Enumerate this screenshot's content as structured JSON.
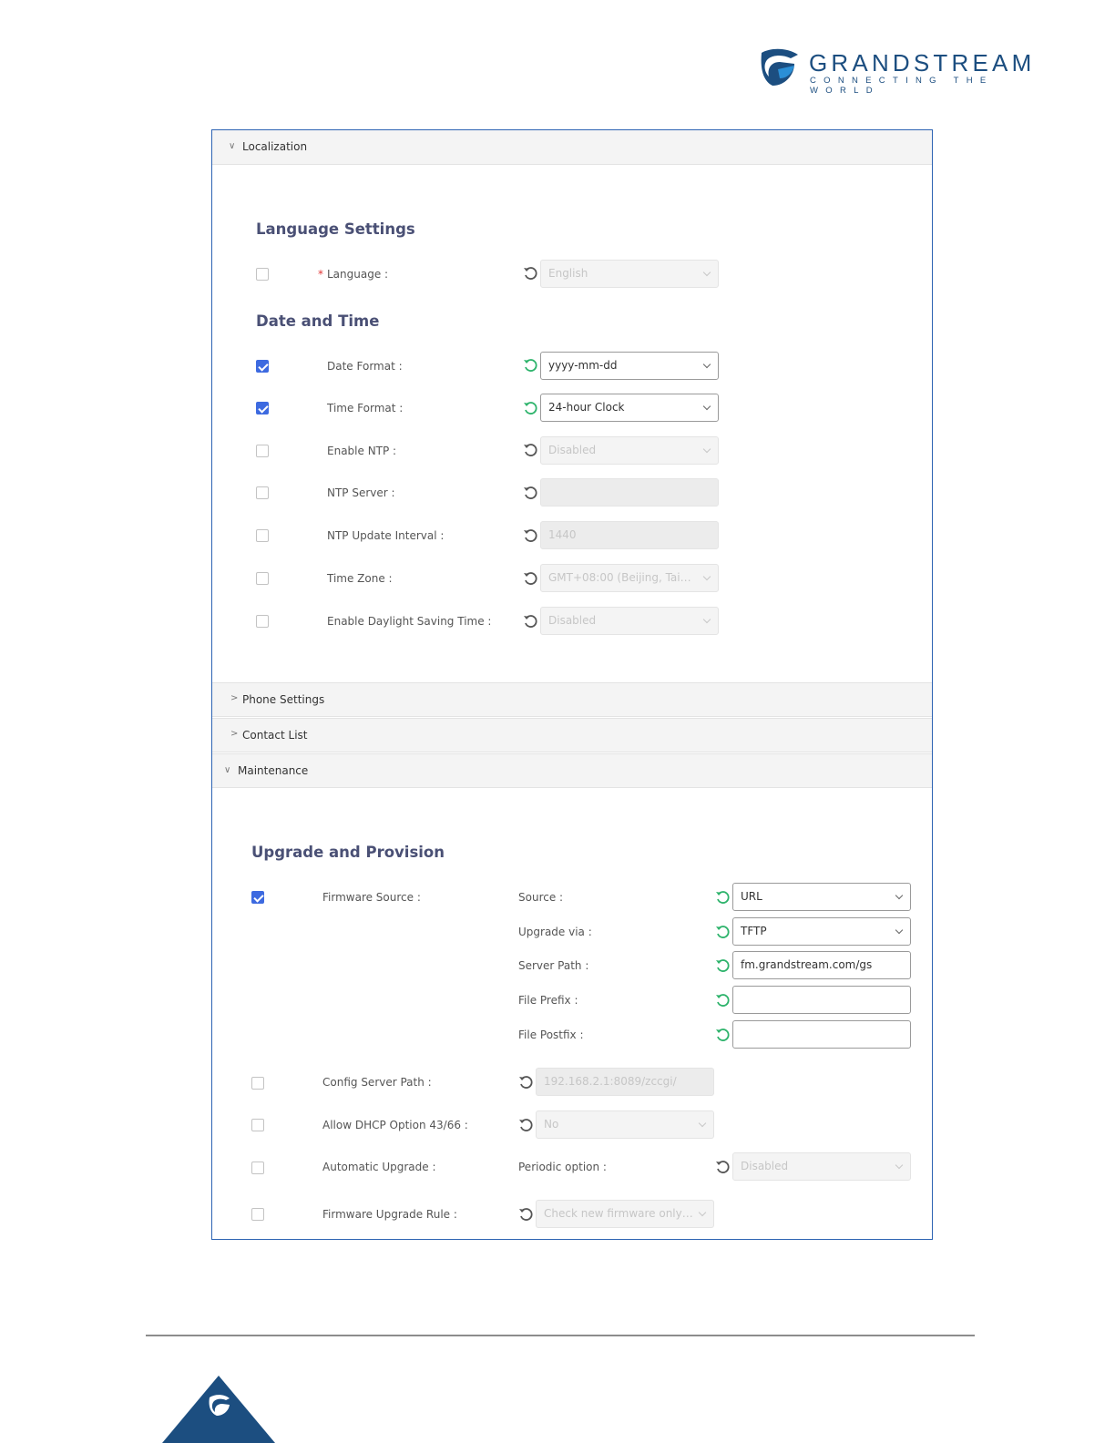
{
  "header": {
    "brand": "GRANDSTREAM",
    "tagline": "CONNECTING THE WORLD"
  },
  "colors": {
    "accent": "#3d6ae0",
    "brand": "#1c4e80",
    "reset_active": "#2db36b",
    "title": "#4a5075"
  },
  "sections": {
    "localization": "Localization",
    "phone_settings": "Phone Settings",
    "contact_list": "Contact List",
    "maintenance": "Maintenance"
  },
  "language_settings": {
    "title": "Language Settings",
    "language": {
      "label": "Language :",
      "value": "English",
      "checked": false,
      "enabled": false
    }
  },
  "date_time": {
    "title": "Date and Time",
    "date_format": {
      "label": "Date Format :",
      "value": "yyyy-mm-dd",
      "checked": true,
      "enabled": true
    },
    "time_format": {
      "label": "Time Format :",
      "value": "24-hour Clock",
      "checked": true,
      "enabled": true
    },
    "enable_ntp": {
      "label": "Enable NTP :",
      "value": "Disabled",
      "checked": false,
      "enabled": false
    },
    "ntp_server": {
      "label": "NTP Server :",
      "value": "",
      "checked": false,
      "enabled": false
    },
    "ntp_update_interval": {
      "label": "NTP Update Interval :",
      "value": "1440",
      "checked": false,
      "enabled": false
    },
    "time_zone": {
      "label": "Time Zone :",
      "value": "GMT+08:00 (Beijing, Taipei, ...",
      "checked": false,
      "enabled": false
    },
    "daylight_saving": {
      "label": "Enable Daylight Saving Time :",
      "value": "Disabled",
      "checked": false,
      "enabled": false
    }
  },
  "upgrade_provision": {
    "title": "Upgrade and Provision",
    "firmware_source": {
      "label": "Firmware Source :",
      "checked": true,
      "source": {
        "label": "Source :",
        "value": "URL"
      },
      "upgrade_via": {
        "label": "Upgrade via :",
        "value": "TFTP"
      },
      "server_path": {
        "label": "Server Path :",
        "value": "fm.grandstream.com/gs"
      },
      "file_prefix": {
        "label": "File Prefix :",
        "value": ""
      },
      "file_postfix": {
        "label": "File Postfix :",
        "value": ""
      }
    },
    "config_server_path": {
      "label": "Config Server Path :",
      "value": "192.168.2.1:8089/zccgi/",
      "checked": false
    },
    "allow_dhcp": {
      "label": "Allow DHCP Option 43/66 :",
      "value": "No",
      "checked": false
    },
    "automatic_upgrade": {
      "label": "Automatic Upgrade :",
      "sub_label": "Periodic option :",
      "value": "Disabled",
      "checked": false
    },
    "firmware_upgrade_rule": {
      "label": "Firmware Upgrade Rule :",
      "value": "Check new firmware only w...",
      "checked": false
    }
  }
}
